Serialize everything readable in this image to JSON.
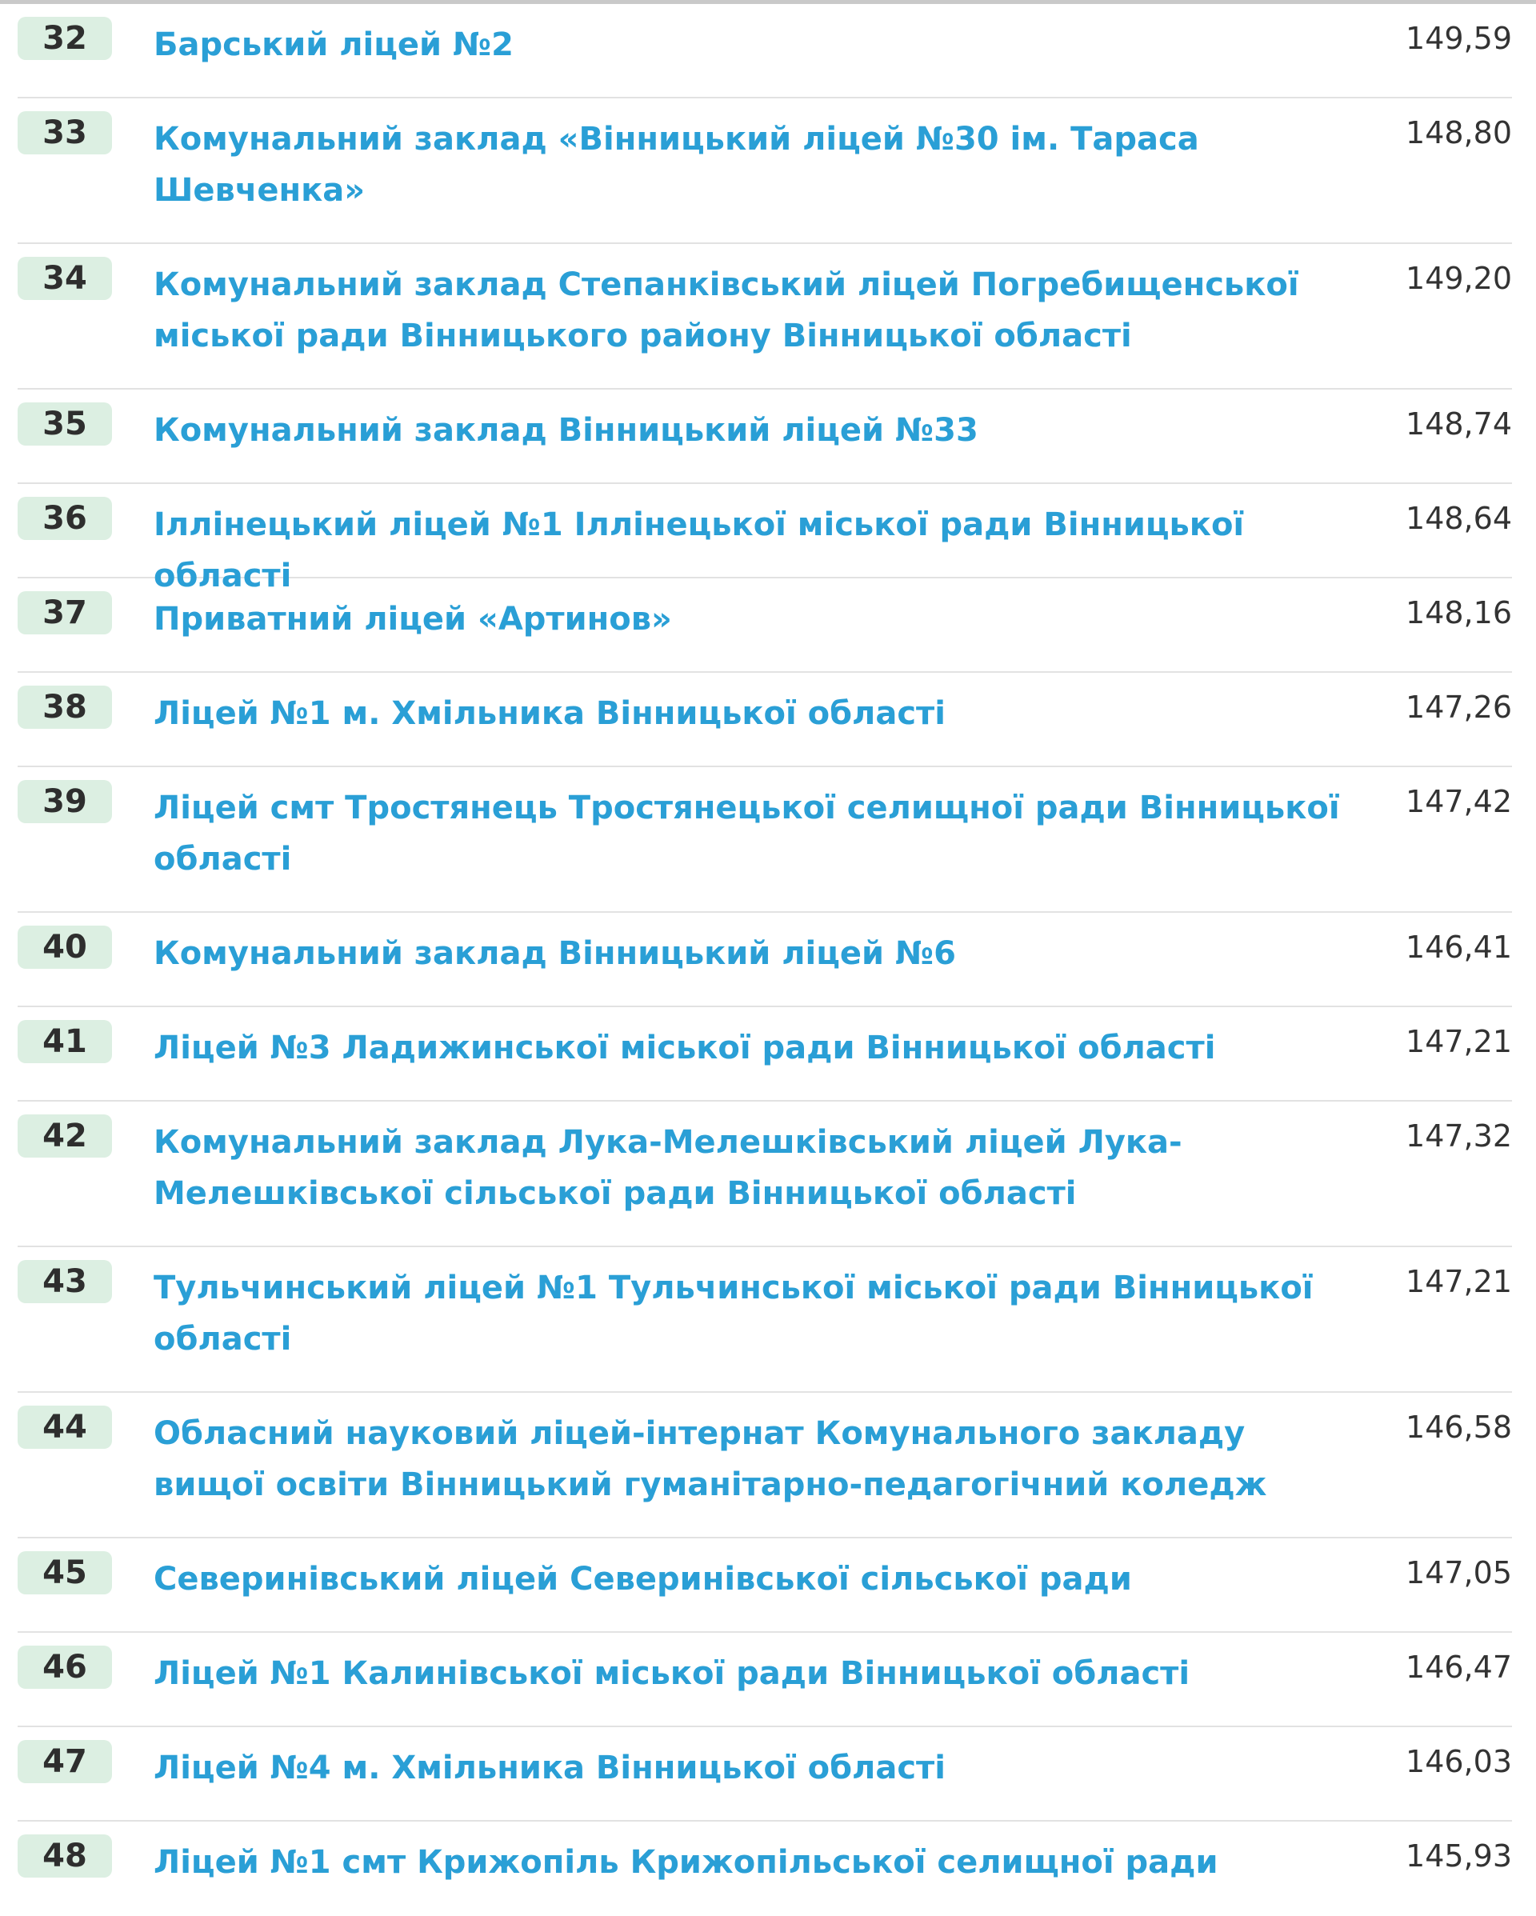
{
  "colors": {
    "link": "#2a9fd6",
    "badge_bg": "#dcefe2",
    "rank_text": "#2e2e2e",
    "score_text": "#333333",
    "divider": "#e2e2e2"
  },
  "rows": [
    {
      "rank": "32",
      "name": "Барський ліцей №2",
      "score": "149,59"
    },
    {
      "rank": "33",
      "name": "Комунальний заклад «Вінницький ліцей №30 ім. Тараса Шевченка»",
      "score": "148,80"
    },
    {
      "rank": "34",
      "name": "Комунальний заклад Степанківський ліцей Погребищенської міської ради Вінницького району Вінницької області",
      "score": "149,20"
    },
    {
      "rank": "35",
      "name": "Комунальний заклад Вінницький ліцей №33",
      "score": "148,74"
    },
    {
      "rank": "36",
      "name": "Іллінецький ліцей №1 Іллінецької міської ради Вінницької області",
      "score": "148,64"
    },
    {
      "rank": "37",
      "name": "Приватний ліцей «Артинов»",
      "score": "148,16"
    },
    {
      "rank": "38",
      "name": "Ліцей №1 м. Хмільника Вінницької області",
      "score": "147,26"
    },
    {
      "rank": "39",
      "name": "Ліцей смт Тростянець Тростянецької селищної ради Вінницької області",
      "score": "147,42"
    },
    {
      "rank": "40",
      "name": "Комунальний заклад Вінницький ліцей №6",
      "score": "146,41"
    },
    {
      "rank": "41",
      "name": "Ліцей №3 Ладижинської міської ради Вінницької області",
      "score": "147,21"
    },
    {
      "rank": "42",
      "name": "Комунальний заклад Лука-Мелешківський ліцей Лука-Мелешківської сільської ради Вінницької області",
      "score": "147,32"
    },
    {
      "rank": "43",
      "name": "Тульчинський ліцей №1 Тульчинської міської ради Вінницької області",
      "score": "147,21"
    },
    {
      "rank": "44",
      "name": "Обласний науковий ліцей-інтернат Комунального закладу вищої освіти Вінницький гуманітарно-педагогічний коледж",
      "score": "146,58"
    },
    {
      "rank": "45",
      "name": "Северинівський ліцей Северинівської сільської ради",
      "score": "147,05"
    },
    {
      "rank": "46",
      "name": "Ліцей №1 Калинівської міської ради Вінницької області",
      "score": "146,47"
    },
    {
      "rank": "47",
      "name": "Ліцей №4 м. Хмільника Вінницької області",
      "score": "146,03"
    },
    {
      "rank": "48",
      "name": "Ліцей №1 смт Крижопіль Крижопільської селищної ради",
      "score": "145,93"
    }
  ]
}
